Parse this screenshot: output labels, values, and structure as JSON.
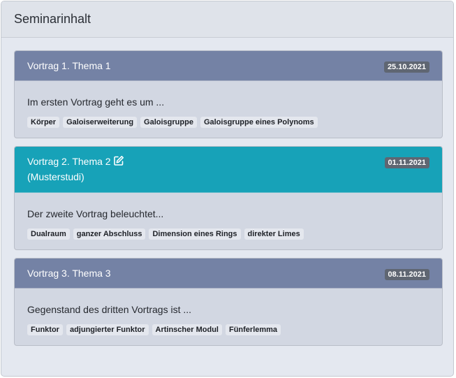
{
  "panel": {
    "title": "Seminarinhalt"
  },
  "talks": [
    {
      "title": "Vortrag 1. Thema 1",
      "subtitle": "",
      "date": "25.10.2021",
      "description": "Im ersten Vortrag geht es um ...",
      "tags": [
        "Körper",
        "Galoiserweiterung",
        "Galoisgruppe",
        "Galoisgruppe eines Polynoms"
      ]
    },
    {
      "title": "Vortrag 2. Thema 2",
      "subtitle": "(Musterstudi)",
      "date": "01.11.2021",
      "description": "Der zweite Vortrag beleuchtet...",
      "tags": [
        "Dualraum",
        "ganzer Abschluss",
        "Dimension eines Rings",
        "direkter Limes"
      ]
    },
    {
      "title": "Vortrag 3. Thema 3",
      "subtitle": "",
      "date": "08.11.2021",
      "description": "Gegenstand des dritten Vortrags ist ...",
      "tags": [
        "Funktor",
        "adjungierter Funktor",
        "Artinscher Modul",
        "Fünferlemma"
      ]
    }
  ],
  "colors": {
    "header_default": "#7482a5",
    "header_active": "#17a2b8",
    "badge": "#5f6672"
  },
  "icons": {
    "edit": "edit-square-icon"
  }
}
